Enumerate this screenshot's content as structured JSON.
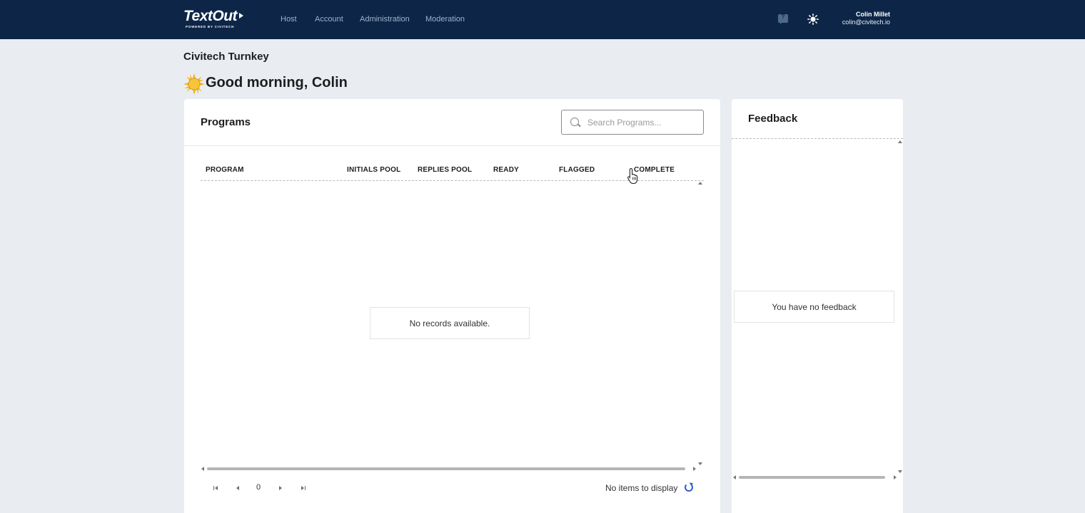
{
  "header": {
    "logo_text": "TextOut",
    "logo_sub": "POWERED BY CIVITECH",
    "nav": [
      "Host",
      "Account",
      "Administration",
      "Moderation"
    ],
    "icons": [
      "help-icon",
      "sun-icon"
    ],
    "user": {
      "name": "Colin Millet",
      "email": "colin@civitech.io"
    }
  },
  "page": {
    "org_name": "Civitech Turnkey",
    "greeting": "Good morning, Colin"
  },
  "programs": {
    "title": "Programs",
    "search_placeholder": "Search Programs...",
    "columns": [
      "PROGRAM",
      "INITIALS POOL",
      "REPLIES POOL",
      "READY",
      "FLAGGED",
      "COMPLETE"
    ],
    "empty_message": "No records available.",
    "pager": {
      "page": "0",
      "status": "No items to display"
    }
  },
  "feedback": {
    "title": "Feedback",
    "empty_message": "You have no feedback"
  },
  "colors": {
    "topbar": "#0d2648",
    "background": "#e9edf1",
    "accent": "#2f62c9"
  }
}
